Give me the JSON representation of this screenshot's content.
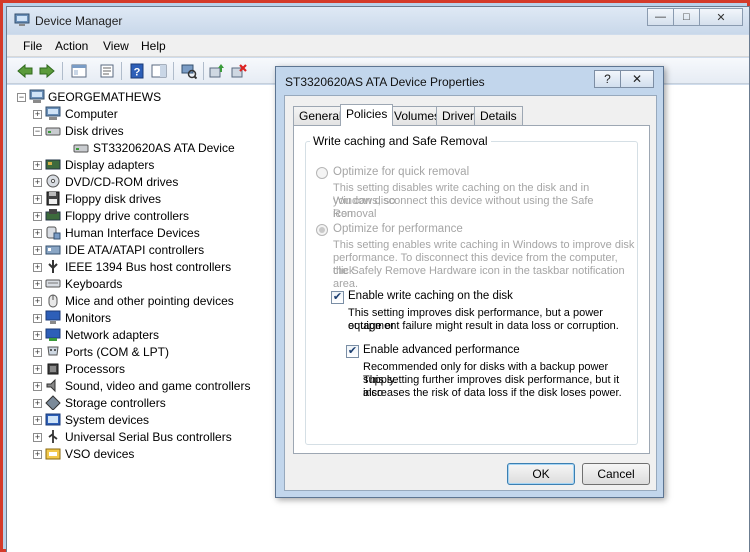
{
  "window": {
    "title": "Device Manager",
    "caption": {
      "minimize": "—",
      "maximize": "□",
      "close": "✕"
    }
  },
  "menu": [
    "File",
    "Action",
    "View",
    "Help"
  ],
  "toolbar": {
    "icons": [
      "back-icon",
      "forward-icon",
      "show-hide-tree-icon",
      "properties-icon",
      "help-icon",
      "action-pane-icon",
      "scan-hardware-icon",
      "update-driver-icon",
      "uninstall-icon"
    ]
  },
  "tree": {
    "root": "GEORGEMATHEWS",
    "items": [
      {
        "label": "Computer",
        "icon": "computer-icon",
        "expander": "+"
      },
      {
        "label": "Disk drives",
        "icon": "disk-drive-icon",
        "expander": "−"
      },
      {
        "label": "ST3320620AS ATA Device",
        "icon": "disk-drive-icon",
        "expander": "",
        "child": true
      },
      {
        "label": "Display adapters",
        "icon": "display-adapter-icon",
        "expander": "+"
      },
      {
        "label": "DVD/CD-ROM drives",
        "icon": "dvd-drive-icon",
        "expander": "+"
      },
      {
        "label": "Floppy disk drives",
        "icon": "floppy-drive-icon",
        "expander": "+"
      },
      {
        "label": "Floppy drive controllers",
        "icon": "floppy-controller-icon",
        "expander": "+"
      },
      {
        "label": "Human Interface Devices",
        "icon": "hid-icon",
        "expander": "+"
      },
      {
        "label": "IDE ATA/ATAPI controllers",
        "icon": "ide-controller-icon",
        "expander": "+"
      },
      {
        "label": "IEEE 1394 Bus host controllers",
        "icon": "ieee1394-icon",
        "expander": "+"
      },
      {
        "label": "Keyboards",
        "icon": "keyboard-icon",
        "expander": "+"
      },
      {
        "label": "Mice and other pointing devices",
        "icon": "mouse-icon",
        "expander": "+"
      },
      {
        "label": "Monitors",
        "icon": "monitor-icon",
        "expander": "+"
      },
      {
        "label": "Network adapters",
        "icon": "network-adapter-icon",
        "expander": "+"
      },
      {
        "label": "Ports (COM & LPT)",
        "icon": "port-icon",
        "expander": "+"
      },
      {
        "label": "Processors",
        "icon": "processor-icon",
        "expander": "+"
      },
      {
        "label": "Sound, video and game controllers",
        "icon": "sound-icon",
        "expander": "+"
      },
      {
        "label": "Storage controllers",
        "icon": "storage-controller-icon",
        "expander": "+"
      },
      {
        "label": "System devices",
        "icon": "system-device-icon",
        "expander": "+"
      },
      {
        "label": "Universal Serial Bus controllers",
        "icon": "usb-icon",
        "expander": "+"
      },
      {
        "label": "VSO devices",
        "icon": "vso-device-icon",
        "expander": "+"
      }
    ]
  },
  "dialog": {
    "title": "ST3320620AS ATA Device Properties",
    "help_label": "?",
    "close_label": "✕",
    "tabs": [
      "General",
      "Policies",
      "Volumes",
      "Driver",
      "Details"
    ],
    "active_tab": "Policies",
    "group_title": "Write caching and Safe Removal",
    "options": {
      "quick_removal": {
        "label": "Optimize for quick removal",
        "desc": [
          "This setting disables write caching on the disk and in Windows, so",
          "you can disconnect this device without using the Safe Removal",
          "icon."
        ],
        "checked": false
      },
      "performance": {
        "label": "Optimize for performance",
        "desc": [
          "This setting enables write caching in Windows to improve disk",
          "performance. To disconnect this device from the computer, click",
          "the Safely Remove Hardware icon in the taskbar notification area."
        ],
        "checked": true
      },
      "write_caching": {
        "label": "Enable write caching on the disk",
        "desc": [
          "This setting improves disk performance, but a power outage or",
          "equipment failure might result in data loss or corruption."
        ],
        "checked": true
      },
      "advanced": {
        "label": "Enable advanced performance",
        "desc": [
          "Recommended only for disks with a backup power supply.",
          "This setting further improves disk performance, but it also",
          "increases the risk of data loss if the disk loses power."
        ],
        "checked": true
      }
    },
    "ok_label": "OK",
    "cancel_label": "Cancel"
  },
  "colors": {
    "frame": "#d43a2a",
    "title_bg": "#dfe9f5",
    "selected": "#3399ff"
  }
}
